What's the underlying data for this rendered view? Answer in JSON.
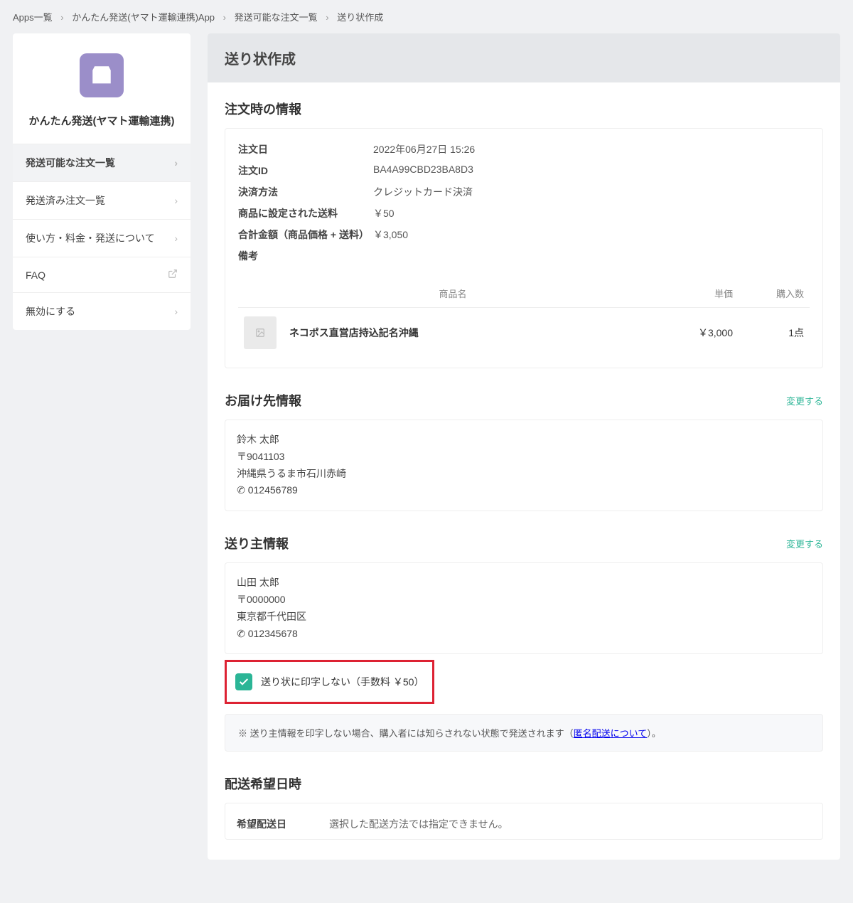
{
  "breadcrumb": [
    "Apps一覧",
    "かんたん発送(ヤマト運輸連携)App",
    "発送可能な注文一覧",
    "送り状作成"
  ],
  "sidebar": {
    "title": "かんたん発送(ヤマト運輸連携)",
    "items": [
      {
        "label": "発送可能な注文一覧",
        "active": true
      },
      {
        "label": "発送済み注文一覧"
      },
      {
        "label": "使い方・料金・発送について"
      },
      {
        "label": "FAQ",
        "external": true
      },
      {
        "label": "無効にする"
      }
    ]
  },
  "pageTitle": "送り状作成",
  "orderInfo": {
    "title": "注文時の情報",
    "rows": [
      {
        "k": "注文日",
        "v": "2022年06月27日 15:26"
      },
      {
        "k": "注文ID",
        "v": "BA4A99CBD23BA8D3"
      },
      {
        "k": "決済方法",
        "v": "クレジットカード決済"
      },
      {
        "k": "商品に設定された送料",
        "v": "￥50"
      },
      {
        "k": "合計金額（商品価格 + 送料）",
        "v": "￥3,050"
      },
      {
        "k": "備考",
        "v": ""
      }
    ],
    "headers": {
      "name": "商品名",
      "price": "単価",
      "qty": "購入数"
    },
    "products": [
      {
        "name": "ネコポス直営店持込記名沖縄",
        "price": "￥3,000",
        "qty": "1点"
      }
    ]
  },
  "delivery": {
    "title": "お届け先情報",
    "changeLabel": "変更する",
    "name": "鈴木 太郎",
    "postal": "〒9041103",
    "address": "沖縄県うるま市石川赤崎",
    "phone": "012456789"
  },
  "sender": {
    "title": "送り主情報",
    "changeLabel": "変更する",
    "name": "山田 太郎",
    "postal": "〒0000000",
    "address": "東京都千代田区",
    "phone": "012345678",
    "checkboxLabel": "送り状に印字しない（手数料 ￥50）",
    "note": "※ 送り主情報を印字しない場合、購入者には知らされない状態で発送されます（",
    "noteLink": "匿名配送について",
    "noteEnd": "）。"
  },
  "deliveryDate": {
    "title": "配送希望日時",
    "row": {
      "k": "希望配送日",
      "v": "選択した配送方法では指定できません。"
    }
  }
}
